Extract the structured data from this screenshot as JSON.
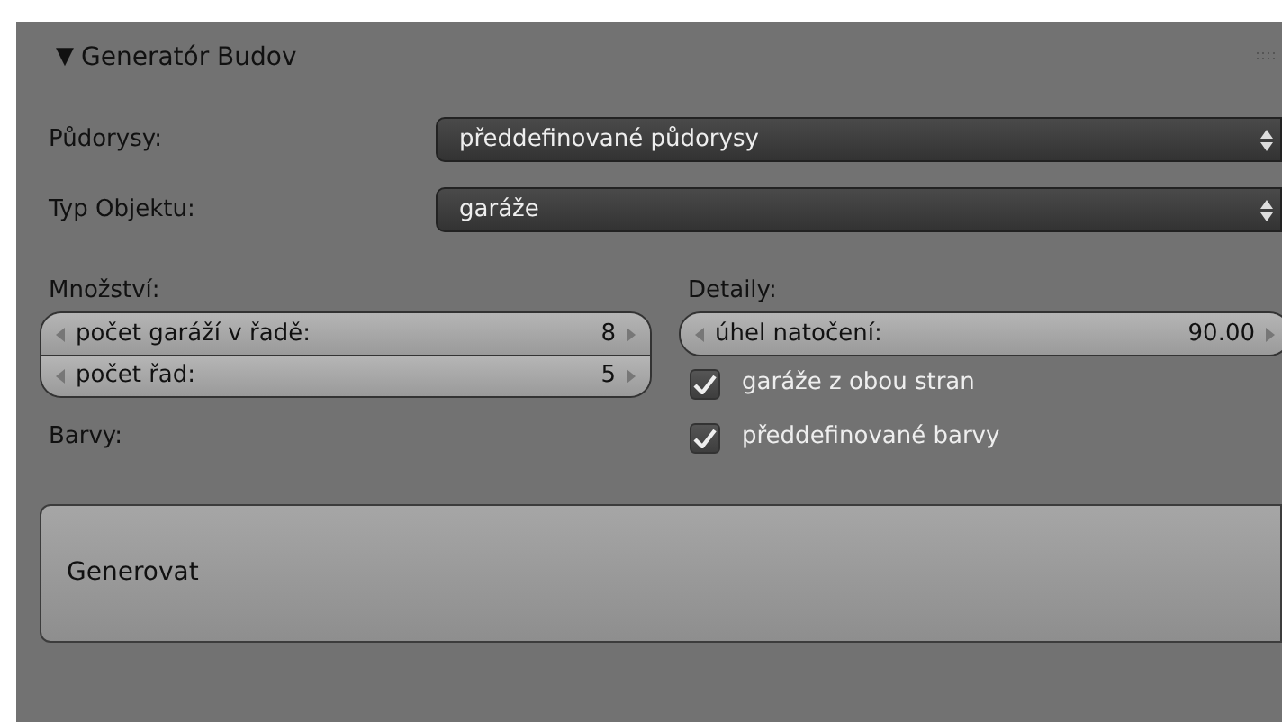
{
  "panel": {
    "title": "Generatór Budov",
    "expanded": true,
    "toggle": "▼"
  },
  "dropdowns": [
    {
      "label": "Půdorysy:",
      "value": "předdefinované půdorysy"
    },
    {
      "label": "Typ Objektu:",
      "value": "garáže"
    }
  ],
  "left": {
    "heading": "Množství:",
    "fields": [
      {
        "label": "počet garáží v řadě:",
        "value": "8"
      },
      {
        "label": "počet řad:",
        "value": "5"
      }
    ]
  },
  "right": {
    "heading": "Detaily:",
    "fields": [
      {
        "label": "úhel natočení:",
        "value": "90.00"
      }
    ],
    "checkboxes": [
      {
        "label": "garáže z obou stran",
        "checked": true
      },
      {
        "label": "předdefinované barvy",
        "checked": true
      }
    ]
  },
  "colors_label": "Barvy:",
  "button": "Generovat"
}
